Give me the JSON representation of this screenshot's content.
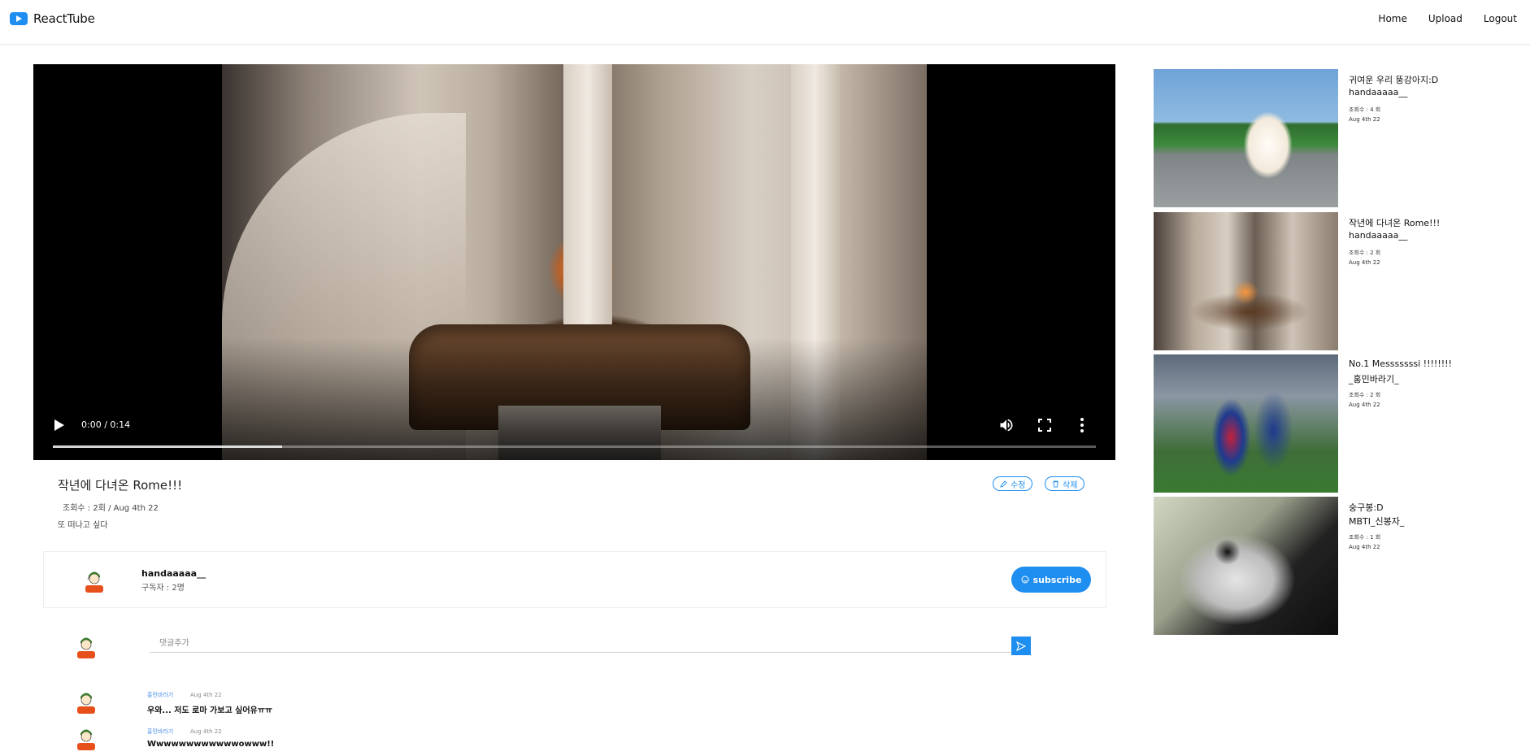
{
  "app": {
    "name": "ReactTube"
  },
  "nav": {
    "home": "Home",
    "upload": "Upload",
    "logout": "Logout"
  },
  "player": {
    "time": "0:00 / 0:14",
    "progress_fraction": 0.22
  },
  "video": {
    "title": "작년에 다녀온 Rome!!!",
    "meta": "조회수 : 2회  /  Aug 4th 22",
    "description": "또 떠나고 싶다",
    "edit_label": "수정",
    "delete_label": "삭제"
  },
  "channel": {
    "name": "handaaaaa__",
    "subscribers": "구독자 : 2명",
    "subscribe_label": "subscribe"
  },
  "comment_input": {
    "placeholder": "댓글추가"
  },
  "comments": [
    {
      "author": "홍민바라기",
      "date": "Aug 4th 22",
      "text": "우와... 저도 로마 가보고 싶어유ㅠㅠ"
    },
    {
      "author": "홍민바라기",
      "date": "Aug 4th 22",
      "text": "Wwwwwwwwwwwwowww!!"
    }
  ],
  "related": [
    {
      "title": "귀여운 우리 뚱강아지:D",
      "author": "handaaaaa__",
      "views": "조회수 : 4 회",
      "date": "Aug 4th 22"
    },
    {
      "title": "작년에 다녀온 Rome!!!",
      "author": "handaaaaa__",
      "views": "조회수 : 2 회",
      "date": "Aug 4th 22"
    },
    {
      "title": "No.1 Messsssssi !!!!!!!!",
      "author": "_홍민바라기_",
      "views": "조회수 : 2 회",
      "date": "Aug 4th 22"
    },
    {
      "title": "숭구봉:D",
      "author": "MBTI_신봉자_",
      "views": "조회수 : 1 회",
      "date": "Aug 4th 22"
    }
  ],
  "colors": {
    "accent": "#1e8ef0",
    "comment_author": "#4a8ee8"
  }
}
